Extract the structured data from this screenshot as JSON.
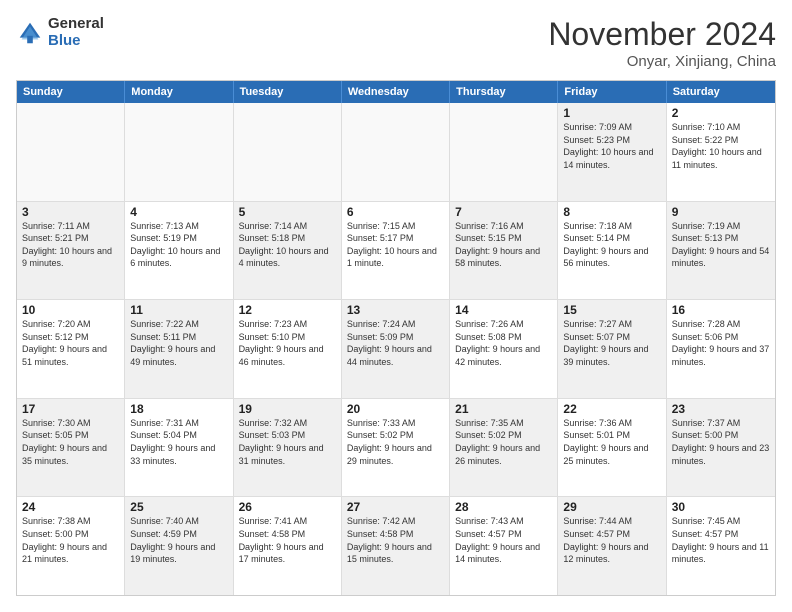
{
  "logo": {
    "general": "General",
    "blue": "Blue"
  },
  "title": "November 2024",
  "location": "Onyar, Xinjiang, China",
  "header_days": [
    "Sunday",
    "Monday",
    "Tuesday",
    "Wednesday",
    "Thursday",
    "Friday",
    "Saturday"
  ],
  "rows": [
    [
      {
        "day": "",
        "text": "",
        "empty": true
      },
      {
        "day": "",
        "text": "",
        "empty": true
      },
      {
        "day": "",
        "text": "",
        "empty": true
      },
      {
        "day": "",
        "text": "",
        "empty": true
      },
      {
        "day": "",
        "text": "",
        "empty": true
      },
      {
        "day": "1",
        "text": "Sunrise: 7:09 AM\nSunset: 5:23 PM\nDaylight: 10 hours and 14 minutes.",
        "empty": false,
        "shaded": true
      },
      {
        "day": "2",
        "text": "Sunrise: 7:10 AM\nSunset: 5:22 PM\nDaylight: 10 hours and 11 minutes.",
        "empty": false,
        "shaded": false
      }
    ],
    [
      {
        "day": "3",
        "text": "Sunrise: 7:11 AM\nSunset: 5:21 PM\nDaylight: 10 hours and 9 minutes.",
        "empty": false,
        "shaded": true
      },
      {
        "day": "4",
        "text": "Sunrise: 7:13 AM\nSunset: 5:19 PM\nDaylight: 10 hours and 6 minutes.",
        "empty": false,
        "shaded": false
      },
      {
        "day": "5",
        "text": "Sunrise: 7:14 AM\nSunset: 5:18 PM\nDaylight: 10 hours and 4 minutes.",
        "empty": false,
        "shaded": true
      },
      {
        "day": "6",
        "text": "Sunrise: 7:15 AM\nSunset: 5:17 PM\nDaylight: 10 hours and 1 minute.",
        "empty": false,
        "shaded": false
      },
      {
        "day": "7",
        "text": "Sunrise: 7:16 AM\nSunset: 5:15 PM\nDaylight: 9 hours and 58 minutes.",
        "empty": false,
        "shaded": true
      },
      {
        "day": "8",
        "text": "Sunrise: 7:18 AM\nSunset: 5:14 PM\nDaylight: 9 hours and 56 minutes.",
        "empty": false,
        "shaded": false
      },
      {
        "day": "9",
        "text": "Sunrise: 7:19 AM\nSunset: 5:13 PM\nDaylight: 9 hours and 54 minutes.",
        "empty": false,
        "shaded": true
      }
    ],
    [
      {
        "day": "10",
        "text": "Sunrise: 7:20 AM\nSunset: 5:12 PM\nDaylight: 9 hours and 51 minutes.",
        "empty": false,
        "shaded": false
      },
      {
        "day": "11",
        "text": "Sunrise: 7:22 AM\nSunset: 5:11 PM\nDaylight: 9 hours and 49 minutes.",
        "empty": false,
        "shaded": true
      },
      {
        "day": "12",
        "text": "Sunrise: 7:23 AM\nSunset: 5:10 PM\nDaylight: 9 hours and 46 minutes.",
        "empty": false,
        "shaded": false
      },
      {
        "day": "13",
        "text": "Sunrise: 7:24 AM\nSunset: 5:09 PM\nDaylight: 9 hours and 44 minutes.",
        "empty": false,
        "shaded": true
      },
      {
        "day": "14",
        "text": "Sunrise: 7:26 AM\nSunset: 5:08 PM\nDaylight: 9 hours and 42 minutes.",
        "empty": false,
        "shaded": false
      },
      {
        "day": "15",
        "text": "Sunrise: 7:27 AM\nSunset: 5:07 PM\nDaylight: 9 hours and 39 minutes.",
        "empty": false,
        "shaded": true
      },
      {
        "day": "16",
        "text": "Sunrise: 7:28 AM\nSunset: 5:06 PM\nDaylight: 9 hours and 37 minutes.",
        "empty": false,
        "shaded": false
      }
    ],
    [
      {
        "day": "17",
        "text": "Sunrise: 7:30 AM\nSunset: 5:05 PM\nDaylight: 9 hours and 35 minutes.",
        "empty": false,
        "shaded": true
      },
      {
        "day": "18",
        "text": "Sunrise: 7:31 AM\nSunset: 5:04 PM\nDaylight: 9 hours and 33 minutes.",
        "empty": false,
        "shaded": false
      },
      {
        "day": "19",
        "text": "Sunrise: 7:32 AM\nSunset: 5:03 PM\nDaylight: 9 hours and 31 minutes.",
        "empty": false,
        "shaded": true
      },
      {
        "day": "20",
        "text": "Sunrise: 7:33 AM\nSunset: 5:02 PM\nDaylight: 9 hours and 29 minutes.",
        "empty": false,
        "shaded": false
      },
      {
        "day": "21",
        "text": "Sunrise: 7:35 AM\nSunset: 5:02 PM\nDaylight: 9 hours and 26 minutes.",
        "empty": false,
        "shaded": true
      },
      {
        "day": "22",
        "text": "Sunrise: 7:36 AM\nSunset: 5:01 PM\nDaylight: 9 hours and 25 minutes.",
        "empty": false,
        "shaded": false
      },
      {
        "day": "23",
        "text": "Sunrise: 7:37 AM\nSunset: 5:00 PM\nDaylight: 9 hours and 23 minutes.",
        "empty": false,
        "shaded": true
      }
    ],
    [
      {
        "day": "24",
        "text": "Sunrise: 7:38 AM\nSunset: 5:00 PM\nDaylight: 9 hours and 21 minutes.",
        "empty": false,
        "shaded": false
      },
      {
        "day": "25",
        "text": "Sunrise: 7:40 AM\nSunset: 4:59 PM\nDaylight: 9 hours and 19 minutes.",
        "empty": false,
        "shaded": true
      },
      {
        "day": "26",
        "text": "Sunrise: 7:41 AM\nSunset: 4:58 PM\nDaylight: 9 hours and 17 minutes.",
        "empty": false,
        "shaded": false
      },
      {
        "day": "27",
        "text": "Sunrise: 7:42 AM\nSunset: 4:58 PM\nDaylight: 9 hours and 15 minutes.",
        "empty": false,
        "shaded": true
      },
      {
        "day": "28",
        "text": "Sunrise: 7:43 AM\nSunset: 4:57 PM\nDaylight: 9 hours and 14 minutes.",
        "empty": false,
        "shaded": false
      },
      {
        "day": "29",
        "text": "Sunrise: 7:44 AM\nSunset: 4:57 PM\nDaylight: 9 hours and 12 minutes.",
        "empty": false,
        "shaded": true
      },
      {
        "day": "30",
        "text": "Sunrise: 7:45 AM\nSunset: 4:57 PM\nDaylight: 9 hours and 11 minutes.",
        "empty": false,
        "shaded": false
      }
    ]
  ]
}
